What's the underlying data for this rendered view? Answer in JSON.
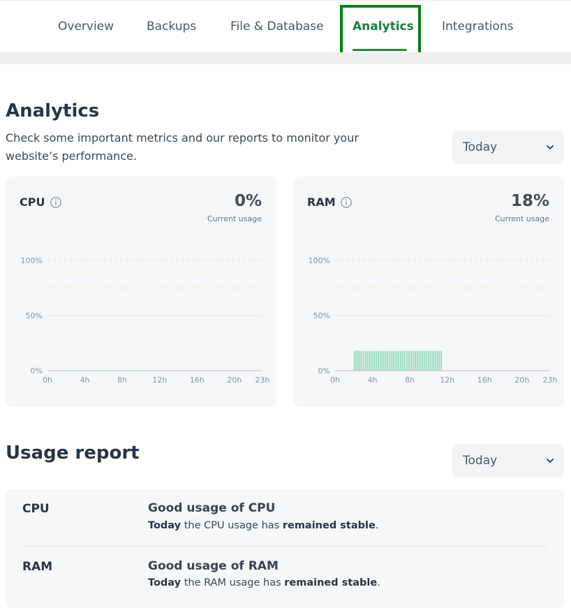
{
  "tabs": [
    {
      "label": "Overview"
    },
    {
      "label": "Backups"
    },
    {
      "label": "File & Database"
    },
    {
      "label": "Analytics",
      "active": true
    },
    {
      "label": "Integrations"
    }
  ],
  "analytics": {
    "title": "Analytics",
    "description": "Check some important metrics and our reports to monitor your website’s performance.",
    "period_select": {
      "value": "Today"
    }
  },
  "cards": [
    {
      "name": "cpu",
      "title": "CPU",
      "value": "0%",
      "subtitle": "Current usage"
    },
    {
      "name": "ram",
      "title": "RAM",
      "value": "18%",
      "subtitle": "Current usage"
    }
  ],
  "chart_data": [
    {
      "type": "bar",
      "title": "CPU",
      "xlabel": "",
      "ylabel": "",
      "x_ticks": [
        "0h",
        "4h",
        "8h",
        "12h",
        "16h",
        "20h",
        "23h"
      ],
      "y_ticks": [
        "0%",
        "50%",
        "100%"
      ],
      "ylim": [
        0,
        100
      ],
      "dashed_lines": [
        75,
        100
      ],
      "start_hour": 2,
      "values": [
        0.4,
        0.4,
        0.4,
        0.4,
        0.4,
        0.4,
        0.4,
        0.4,
        0.4,
        0.4,
        0.4,
        0.4,
        0.4,
        0.4,
        0.4,
        0.4,
        0.4,
        0.4,
        0.4,
        0.4,
        0.4,
        0.4,
        0.4,
        0.4,
        0.4,
        0.4,
        0.4,
        0.4,
        0.4,
        0.4,
        0.4,
        0.4,
        0.4,
        0.4,
        0.4,
        0.4,
        0.4,
        0.4,
        0.4,
        0.4,
        0.4,
        0.4,
        0.4,
        0.4,
        0.4,
        0.4,
        0.4,
        0.4,
        0.4,
        0.4,
        0.4,
        0.4,
        0.4,
        0.4,
        0.4,
        0.4,
        0.4,
        0.4,
        0.4,
        0.4
      ],
      "color": "#7fd3ae"
    },
    {
      "type": "bar",
      "title": "RAM",
      "xlabel": "",
      "ylabel": "",
      "x_ticks": [
        "0h",
        "4h",
        "8h",
        "12h",
        "16h",
        "20h",
        "23h"
      ],
      "y_ticks": [
        "0%",
        "50%",
        "100%"
      ],
      "ylim": [
        0,
        100
      ],
      "dashed_lines": [
        75,
        100
      ],
      "start_hour": 2,
      "values": [
        18,
        18,
        18,
        18,
        18,
        17.5,
        18,
        17.5,
        18,
        17.5,
        18,
        17.5,
        18,
        17.5,
        18,
        17.5,
        18,
        17.5,
        18,
        17.5,
        18,
        17.5,
        18,
        17.5,
        18,
        17.5,
        18,
        18,
        18,
        18,
        18,
        18,
        18,
        18,
        18,
        18,
        18,
        18,
        18,
        18,
        18,
        18,
        18,
        18,
        18,
        18,
        18,
        18
      ],
      "color": "#7fd3ae"
    }
  ],
  "usage_report": {
    "title": "Usage report",
    "period_select": {
      "value": "Today"
    },
    "rows": [
      {
        "label": "CPU",
        "title": "Good usage of CPU",
        "text_prefix": "Today",
        "text_middle": " the CPU usage has ",
        "text_bold": "remained stable",
        "text_suffix": "."
      },
      {
        "label": "RAM",
        "title": "Good usage of RAM",
        "text_prefix": "Today",
        "text_middle": " the RAM usage has ",
        "text_bold": "remained stable",
        "text_suffix": "."
      }
    ]
  },
  "colors": {
    "accent": "#19833c",
    "bar": "#7fd3ae",
    "highlight": "#087f1a"
  }
}
